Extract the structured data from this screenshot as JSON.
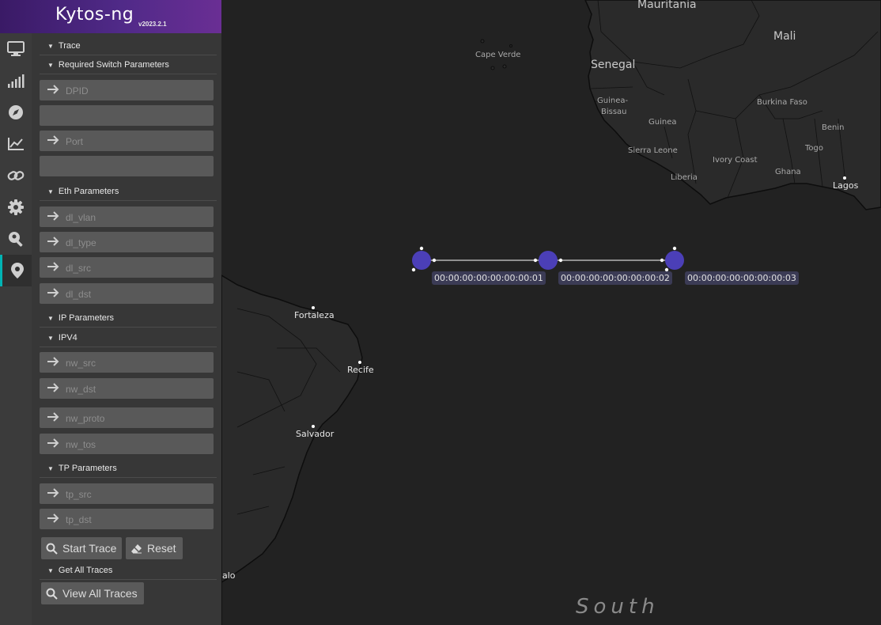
{
  "app": {
    "logo_text": "Kytos-ng",
    "version": "v2023.2.1"
  },
  "sidebar_icons": [
    "monitor-icon",
    "signal-bars-icon",
    "compass-icon",
    "line-chart-icon",
    "link-icon",
    "gear-icon",
    "map-search-icon",
    "map-pin-icon"
  ],
  "panel": {
    "trace_title": "Trace",
    "required_title": "Required Switch Parameters",
    "dpid_placeholder": "DPID",
    "port_placeholder": "Port",
    "eth_title": "Eth Parameters",
    "dl_vlan_placeholder": "dl_vlan",
    "dl_type_placeholder": "dl_type",
    "dl_src_placeholder": "dl_src",
    "dl_dst_placeholder": "dl_dst",
    "ip_title": "IP Parameters",
    "ipv4_title": "IPV4",
    "nw_src_placeholder": "nw_src",
    "nw_dst_placeholder": "nw_dst",
    "nw_proto_placeholder": "nw_proto",
    "nw_tos_placeholder": "nw_tos",
    "tp_title": "TP Parameters",
    "tp_src_placeholder": "tp_src",
    "tp_dst_placeholder": "tp_dst",
    "start_trace_label": "Start Trace",
    "reset_label": "Reset",
    "get_all_title": "Get All Traces",
    "view_all_label": "View All Traces"
  },
  "map": {
    "countries": [
      "Mauritania",
      "Mali",
      "Senegal",
      "Cape Verde",
      "Guinea-",
      "Bissau",
      "Guinea",
      "Burkina Faso",
      "Benin",
      "Togo",
      "Sierra Leone",
      "Ivory Coast",
      "Ghana",
      "Liberia"
    ],
    "cities": [
      "Lagos",
      "Fortaleza",
      "Recife",
      "Salvador",
      "alo"
    ],
    "ocean_label": "South",
    "switches": [
      "00:00:00:00:00:00:00:01",
      "00:00:00:00:00:00:00:02",
      "00:00:00:00:00:00:00:03"
    ],
    "switch_color": "#4b3fb7"
  }
}
